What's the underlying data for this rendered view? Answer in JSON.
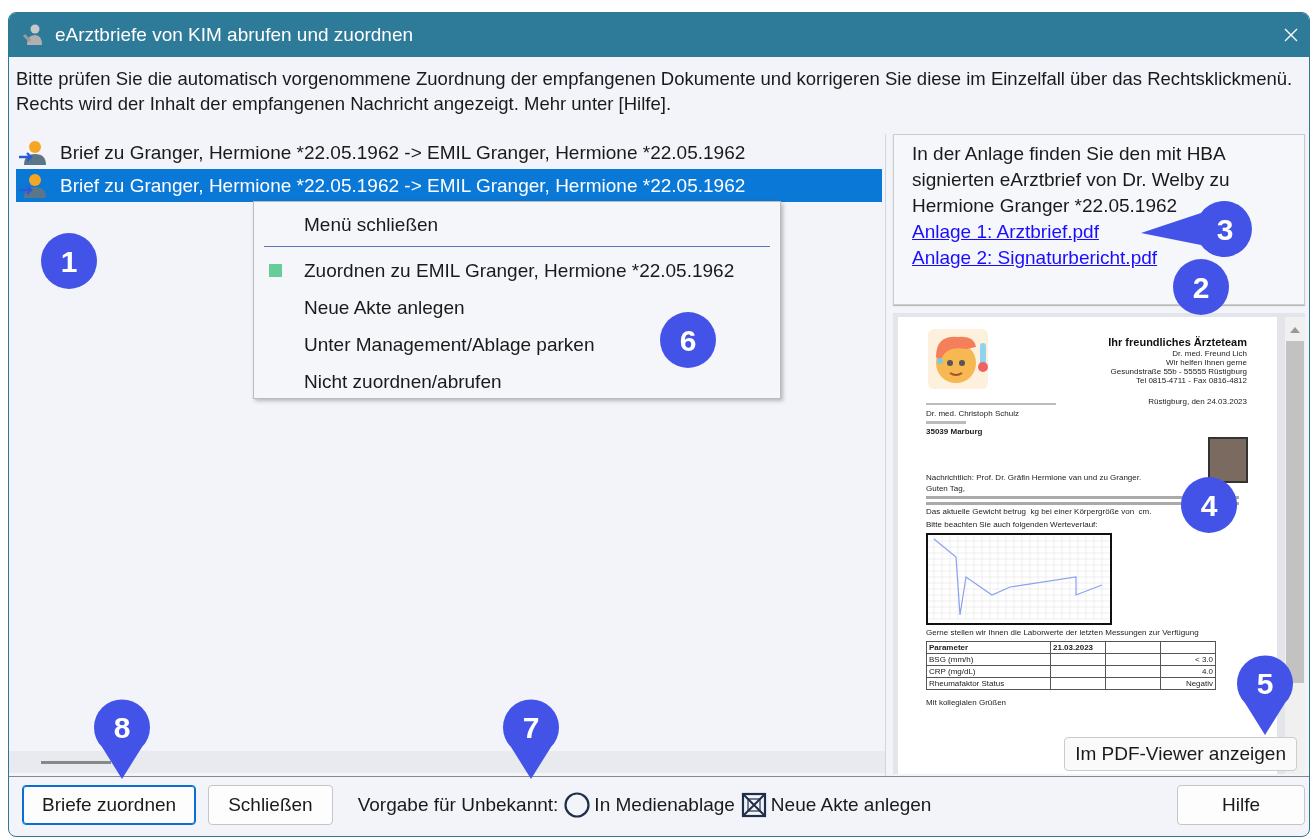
{
  "window": {
    "title": "eArztbriefe von KIM abrufen und zuordnen"
  },
  "instructions": "Bitte prüfen Sie die automatisch vorgenommene Zuordnung der empfangenen Dokumente und korrigeren Sie diese im Einzelfall über das Rechtsklickmenü. Rechts wird der Inhalt der empfangenen Nachricht angezeigt. Mehr unter [Hilfe].",
  "letters": [
    {
      "text": "Brief zu Granger, Hermione *22.05.1962 -> EMIL Granger, Hermione *22.05.1962",
      "selected": false
    },
    {
      "text": "Brief zu Granger, Hermione *22.05.1962 -> EMIL Granger, Hermione *22.05.1962",
      "selected": true
    }
  ],
  "context_menu": [
    {
      "kind": "item",
      "label": "Menü schließen"
    },
    {
      "kind": "separator"
    },
    {
      "kind": "item",
      "label": "Zuordnen zu EMIL Granger, Hermione *22.05.1962",
      "color": "#66cc99"
    },
    {
      "kind": "item",
      "label": "Neue Akte anlegen"
    },
    {
      "kind": "item",
      "label": "Unter Management/Ablage parken"
    },
    {
      "kind": "item",
      "label": "Nicht zuordnen/abrufen"
    }
  ],
  "message": {
    "text": "In der Anlage finden Sie den mit HBA signierten eArztbrief von Dr. Welby zu Hermione Granger *22.05.1962",
    "attachments": [
      "Anlage 1: Arztbrief.pdf",
      "Anlage 2: Signaturbericht.pdf"
    ]
  },
  "preview": {
    "letterhead_title": "Ihr freundliches Ärzteteam",
    "letterhead_lines": [
      "Dr. med. Freund Lich",
      "Wir helfen Ihnen gerne",
      "Gesundstraße 55b - 55555 Rüstigburg",
      "Tel 0815-4711 - Fax 0816-4812"
    ],
    "date": "Rüstigburg, den 24.03.2023",
    "recipient": "Dr. med. Christoph Schulz",
    "city": "35039 Marburg",
    "cc": "Nachrichtlich: Prof. Dr. Gräfin Hermione van und zu Granger.",
    "greeting": "Guten Tag,",
    "weight": "Das aktuelle Gewicht betrug  kg bei einer Körpergröße von  cm.",
    "chart_intro": "Bitte beachten Sie auch folgenden Werteverlauf:",
    "lab_intro": "Gerne stellen wir Ihnen die Laborwerte der letzten Messungen zur Verfügung",
    "lab_columns": [
      "Parameter",
      "21.03.2023"
    ],
    "lab_rows": [
      {
        "name": "BSG (mm/h)",
        "value": "< 3.0"
      },
      {
        "name": "CRP (mg/dL)",
        "value": "4.0"
      },
      {
        "name": "Rheumafaktor Status",
        "value": "Negativ"
      }
    ],
    "closing": "Mit kollegialen Grüßen",
    "open_button": "Im PDF-Viewer anzeigen"
  },
  "footer": {
    "buttons": [
      {
        "label": "Briefe zuordnen",
        "focused": true
      },
      {
        "label": "Schließen",
        "focused": false
      }
    ],
    "default_label": "Vorgabe für Unbekannt:",
    "options": [
      {
        "label": "In Medienablage",
        "selected": false
      },
      {
        "label": "Neue Akte anlegen",
        "selected": true
      }
    ],
    "help_button": "Hilfe"
  },
  "callouts": [
    {
      "label": "1",
      "kind": "circle"
    },
    {
      "label": "2",
      "kind": "circle"
    },
    {
      "label": "3",
      "kind": "pin-left"
    },
    {
      "label": "4",
      "kind": "circle"
    },
    {
      "label": "5",
      "kind": "pin-down"
    },
    {
      "label": "6",
      "kind": "circle"
    },
    {
      "label": "7",
      "kind": "pin-down"
    },
    {
      "label": "8",
      "kind": "pin-down"
    }
  ]
}
